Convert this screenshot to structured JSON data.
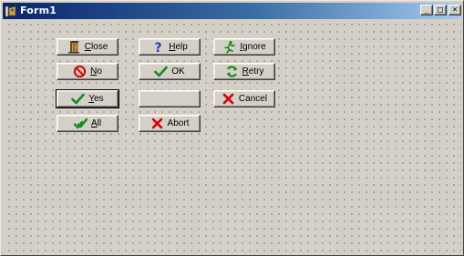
{
  "window": {
    "title": "Form1",
    "caption_buttons": {
      "minimize": "_",
      "maximize": "□",
      "close": "×"
    }
  },
  "buttons": [
    {
      "id": "close",
      "label": "Close",
      "accel_index": 0,
      "icon": "door-exit-icon"
    },
    {
      "id": "help",
      "label": "Help",
      "accel_index": 0,
      "icon": "question-mark-icon"
    },
    {
      "id": "ignore",
      "label": "Ignore",
      "accel_index": 0,
      "icon": "running-figure-icon"
    },
    {
      "id": "no",
      "label": "No",
      "accel_index": 0,
      "icon": "no-entry-icon"
    },
    {
      "id": "ok",
      "label": "OK",
      "accel_index": -1,
      "icon": "checkmark-icon"
    },
    {
      "id": "retry",
      "label": "Retry",
      "accel_index": 0,
      "icon": "refresh-arrows-icon"
    },
    {
      "id": "yes",
      "label": "Yes",
      "accel_index": 0,
      "icon": "checkmark-icon"
    },
    {
      "id": "blank",
      "label": "",
      "accel_index": -1,
      "icon": ""
    },
    {
      "id": "cancel",
      "label": "Cancel",
      "accel_index": -1,
      "icon": "red-x-icon"
    },
    {
      "id": "all",
      "label": "All",
      "accel_index": 0,
      "icon": "double-checkmark-icon"
    },
    {
      "id": "abort",
      "label": "Abort",
      "accel_index": -1,
      "icon": "red-x-icon"
    }
  ],
  "colors": {
    "face": "#d4d0c8",
    "title_start": "#0a246a",
    "title_end": "#a6caf0",
    "check_green": "#1a8a1a",
    "stop_red": "#d40000",
    "help_blue": "#1f3fbf"
  }
}
